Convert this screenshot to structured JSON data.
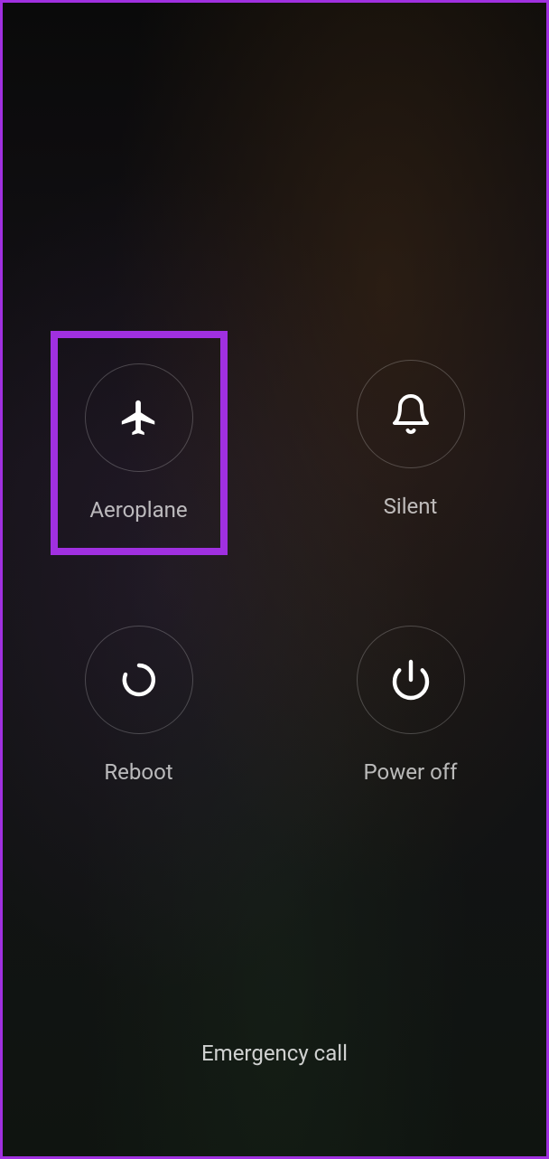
{
  "power_menu": {
    "items": [
      {
        "id": "aeroplane",
        "label": "Aeroplane",
        "icon": "airplane-icon",
        "highlighted": true
      },
      {
        "id": "silent",
        "label": "Silent",
        "icon": "bell-icon",
        "highlighted": false
      },
      {
        "id": "reboot",
        "label": "Reboot",
        "icon": "reboot-icon",
        "highlighted": false
      },
      {
        "id": "poweroff",
        "label": "Power off",
        "icon": "power-icon",
        "highlighted": false
      }
    ]
  },
  "emergency_call_label": "Emergency call",
  "highlight_color": "#a030e0"
}
